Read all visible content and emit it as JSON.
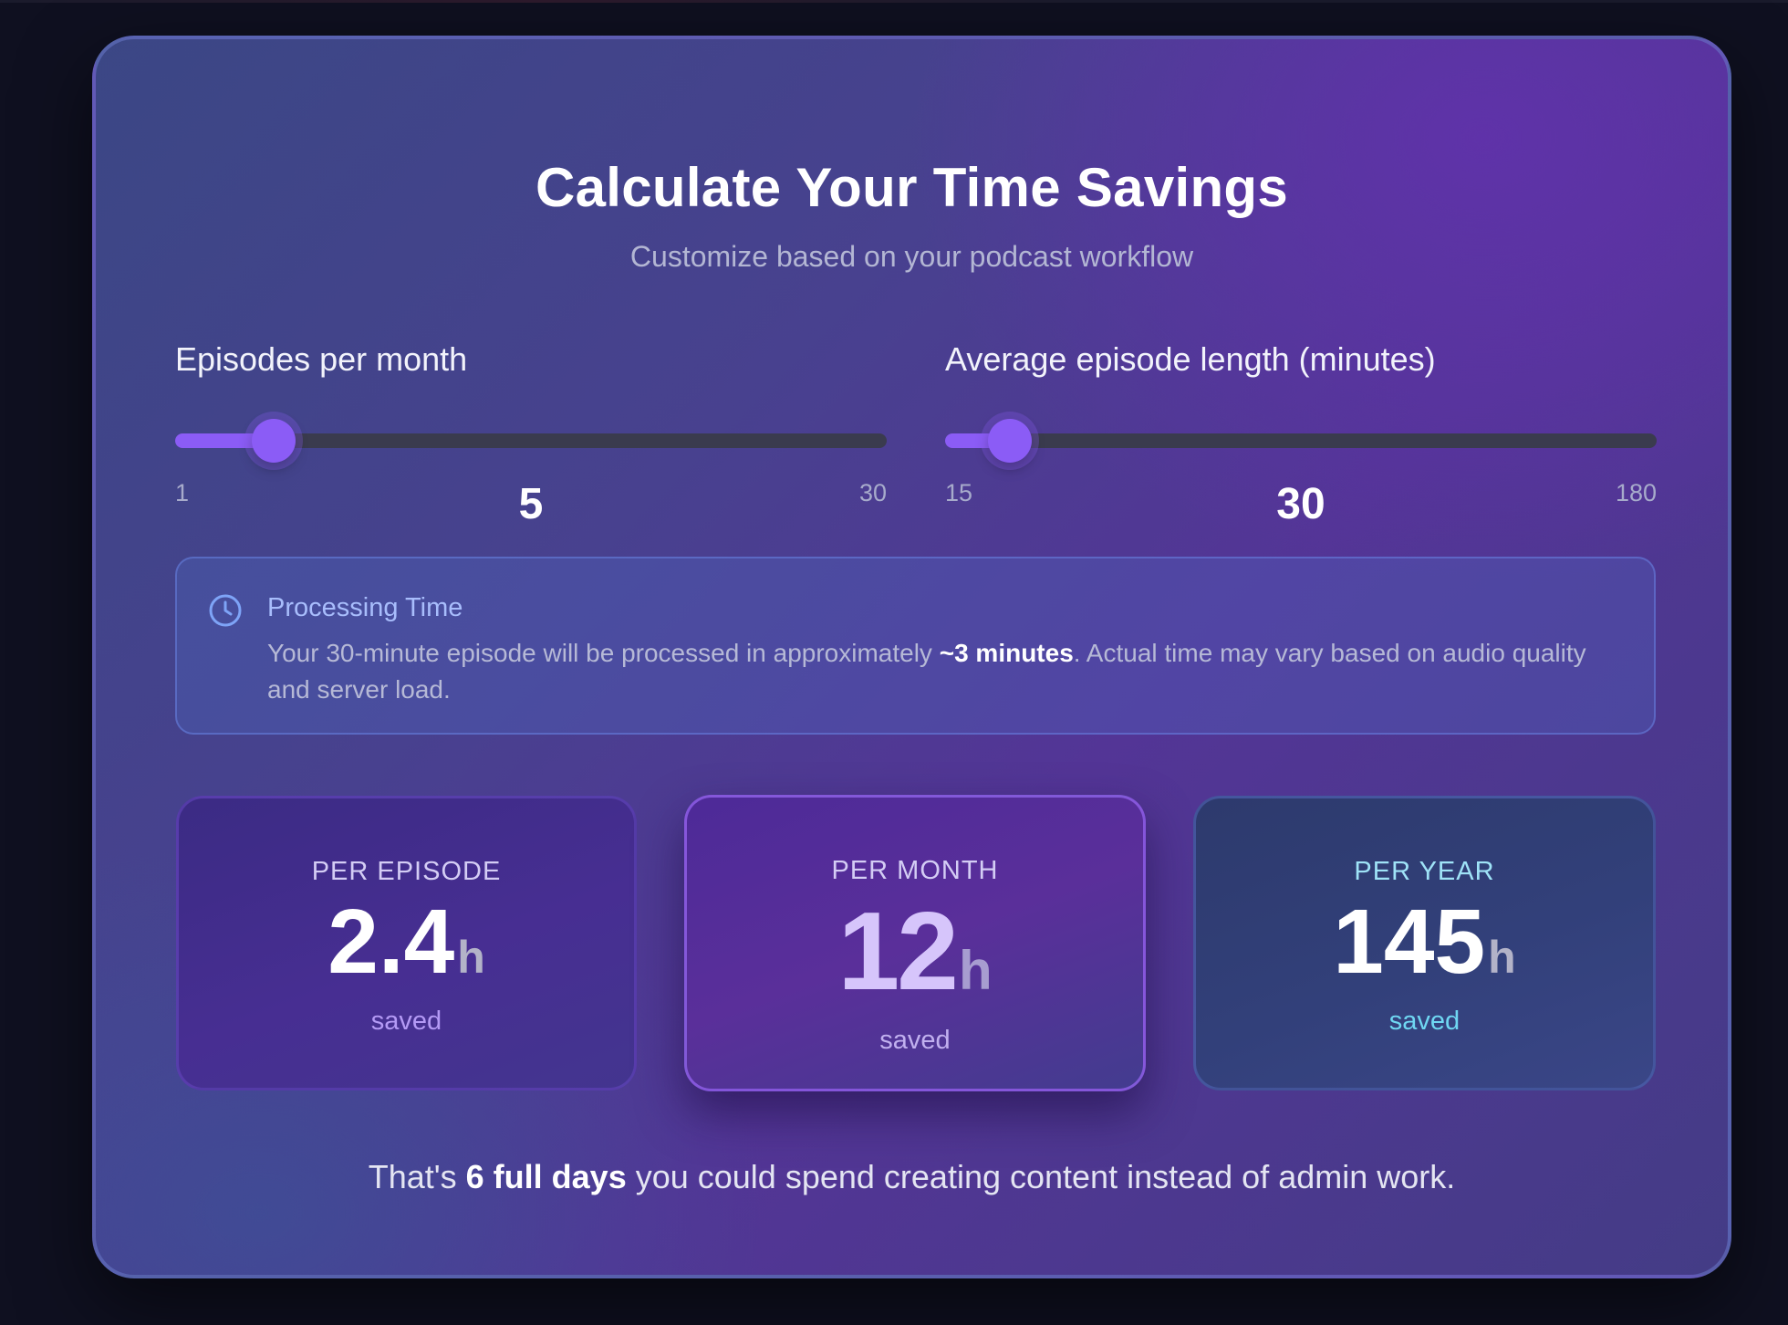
{
  "header": {
    "title": "Calculate Your Time Savings",
    "subtitle": "Customize based on your podcast workflow"
  },
  "sliders": [
    {
      "label": "Episodes per month",
      "min": "1",
      "max": "30",
      "value": "5",
      "fill_fraction": 0.138
    },
    {
      "label": "Average episode length (minutes)",
      "min": "15",
      "max": "180",
      "value": "30",
      "fill_fraction": 0.091
    }
  ],
  "info": {
    "icon": "clock-icon",
    "title": "Processing Time",
    "text_before": "Your 30-minute episode will be processed in approximately ",
    "text_highlight": "~3 minutes",
    "text_after": ". Actual time may vary based on audio quality and server load."
  },
  "stats": [
    {
      "label": "PER EPISODE",
      "value": "2.4",
      "unit": "h",
      "caption": "saved"
    },
    {
      "label": "PER MONTH",
      "value": "12",
      "unit": "h",
      "caption": "saved"
    },
    {
      "label": "PER YEAR",
      "value": "145",
      "unit": "h",
      "caption": "saved"
    }
  ],
  "summary": {
    "before": "That's ",
    "highlight": "6 full days",
    "after": " you could spend creating content instead of admin work."
  },
  "colors": {
    "accent": "#8b5cf6",
    "track": "#3a3b4e",
    "year_accent": "#6fd7f2",
    "background": "#0f1020"
  }
}
